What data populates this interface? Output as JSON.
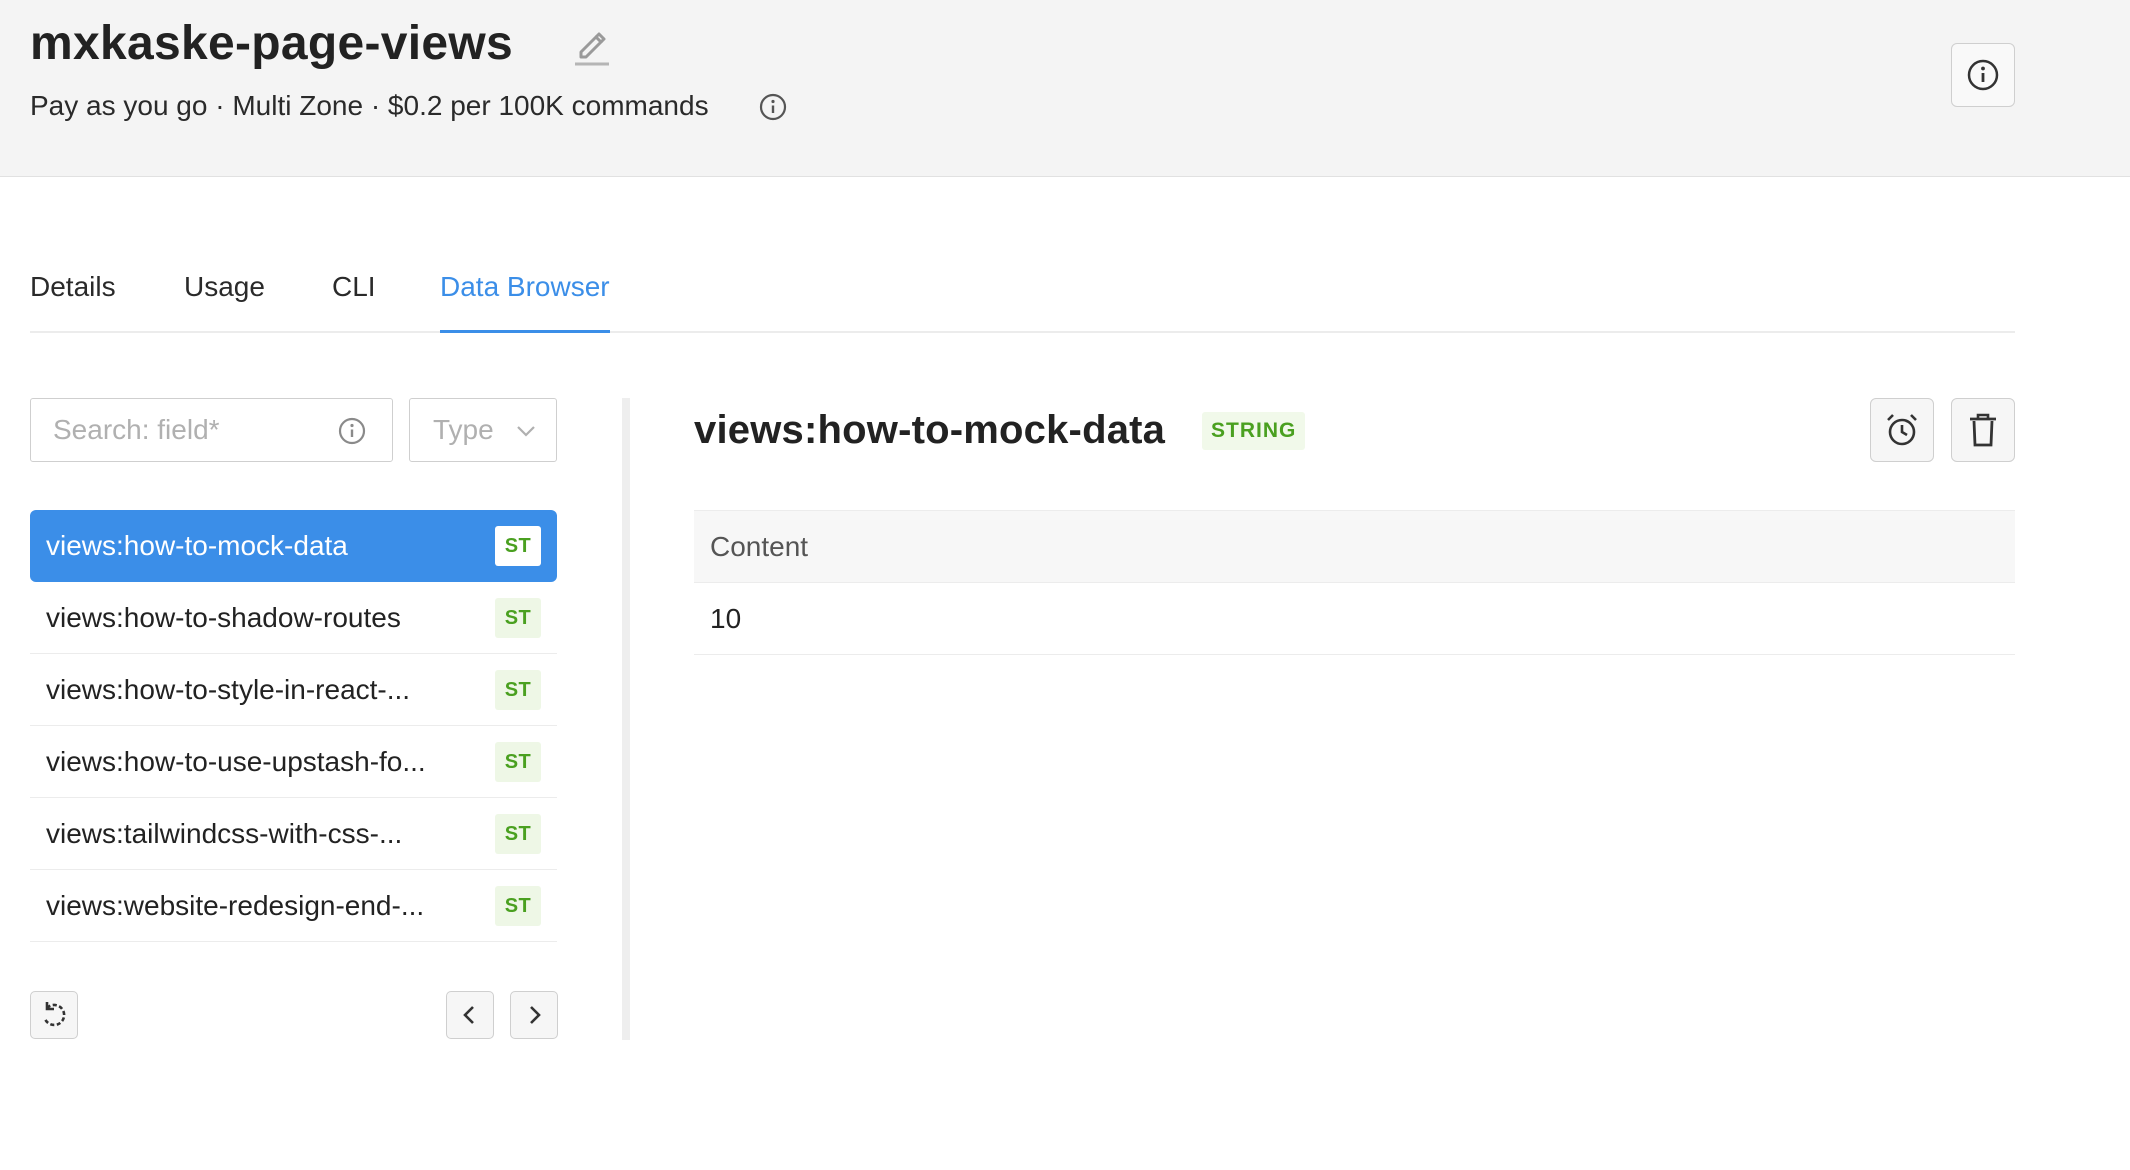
{
  "header": {
    "title": "mxkaske-page-views",
    "plan": "Pay as you go · Multi Zone · $0.2 per 100K commands"
  },
  "tabs": [
    {
      "label": "Details",
      "active": false
    },
    {
      "label": "Usage",
      "active": false
    },
    {
      "label": "CLI",
      "active": false
    },
    {
      "label": "Data Browser",
      "active": true
    }
  ],
  "search": {
    "placeholder": "Search: field*",
    "value": ""
  },
  "type_filter": {
    "label": "Type"
  },
  "keys": [
    {
      "name": "views:how-to-mock-data",
      "type_badge": "ST",
      "selected": true
    },
    {
      "name": "views:how-to-shadow-routes",
      "type_badge": "ST",
      "selected": false
    },
    {
      "name": "views:how-to-style-in-react-...",
      "type_badge": "ST",
      "selected": false
    },
    {
      "name": "views:how-to-use-upstash-fo...",
      "type_badge": "ST",
      "selected": false
    },
    {
      "name": "views:tailwindcss-with-css-...",
      "type_badge": "ST",
      "selected": false
    },
    {
      "name": "views:website-redesign-end-...",
      "type_badge": "ST",
      "selected": false
    }
  ],
  "detail": {
    "key": "views:how-to-mock-data",
    "type": "STRING",
    "content_header": "Content",
    "content_value": "10"
  },
  "colors": {
    "accent": "#3b8ee8",
    "string_badge": "#4aa020",
    "header_bg": "#f4f4f4"
  },
  "icons": {
    "edit": "pencil-icon",
    "info": "info-icon",
    "chevron": "chevron-down-icon",
    "refresh": "refresh-icon",
    "prev": "chevron-left-icon",
    "next": "chevron-right-icon",
    "ttl": "alarm-clock-icon",
    "delete": "trash-icon"
  }
}
